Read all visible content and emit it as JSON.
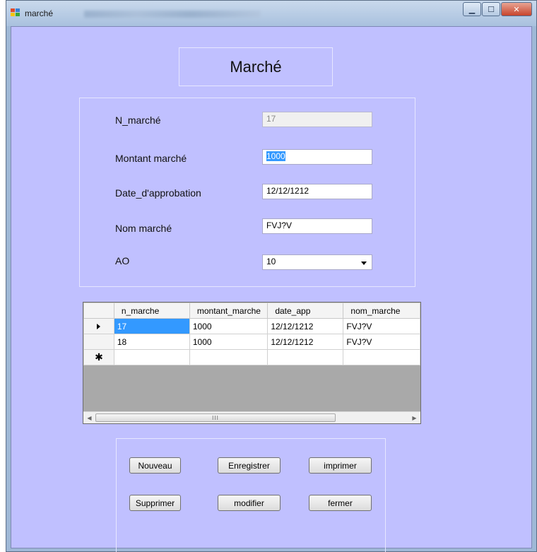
{
  "window": {
    "title": "marché"
  },
  "form": {
    "heading": "Marché",
    "fields": {
      "n_marche": {
        "label": "N_marché",
        "value": "17"
      },
      "montant": {
        "label": "Montant marché",
        "value": "1000"
      },
      "date": {
        "label": "Date_d'approbation",
        "value": "12/12/1212"
      },
      "nom": {
        "label": "Nom marché",
        "value": "FVJ?V"
      },
      "ao": {
        "label": "AO",
        "value": "10"
      }
    }
  },
  "grid": {
    "columns": [
      "n_marche",
      "montant_marche",
      "date_app",
      "nom_marche"
    ],
    "rows": [
      [
        "17",
        "1000",
        "12/12/1212",
        "FVJ?V"
      ],
      [
        "18",
        "1000",
        "12/12/1212",
        "FVJ?V"
      ]
    ],
    "new_row_marker": "✱",
    "scroll_thumb_grip": "III"
  },
  "buttons": {
    "nouveau": "Nouveau",
    "enregistrer": "Enregistrer",
    "imprimer": "imprimer",
    "supprimer": "Supprimer",
    "modifier": "modifier",
    "fermer": "fermer"
  },
  "colors": {
    "client_bg": "#c0c0ff",
    "selection": "#3399ff",
    "close_button": "#c7442c"
  },
  "icons": {
    "app": "app-window-icon",
    "minimize": "minimize-icon",
    "maximize": "maximize-icon",
    "close": "close-icon",
    "row_pointer": "current-row-pointer-icon"
  }
}
